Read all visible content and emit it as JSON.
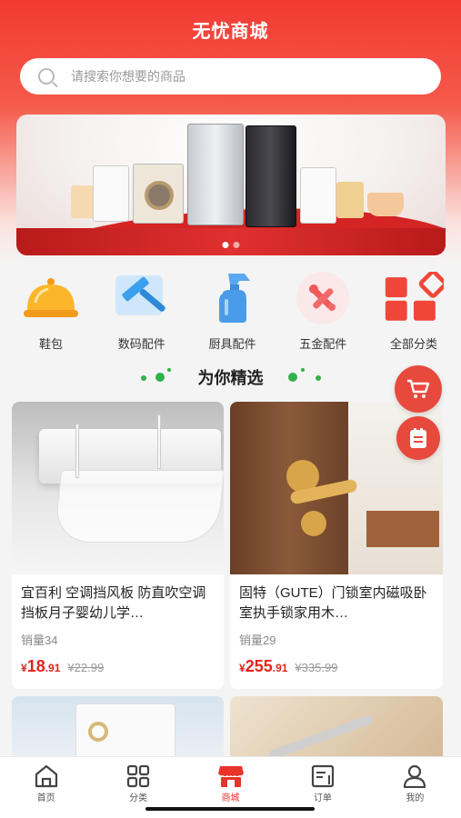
{
  "app": {
    "title": "无忧商城"
  },
  "search": {
    "placeholder": "请搜索你想要的商品"
  },
  "categories": [
    {
      "label": "鞋包",
      "icon": "food-cover-icon"
    },
    {
      "label": "数码配件",
      "icon": "squeegee-icon"
    },
    {
      "label": "厨具配件",
      "icon": "spray-bottle-icon"
    },
    {
      "label": "五金配件",
      "icon": "tools-icon"
    },
    {
      "label": "全部分类",
      "icon": "grid-icon"
    }
  ],
  "section": {
    "title": "为你精选"
  },
  "products": [
    {
      "name": "宜百利 空调挡风板 防直吹空调挡板月子婴幼儿学…",
      "sales": "销量34",
      "currency": "¥",
      "price_int": "18",
      "price_dec": ".91",
      "price_old": "¥22.99"
    },
    {
      "name": "固特（GUTE）门锁室内磁吸卧室执手锁家用木…",
      "sales": "销量29",
      "currency": "¥",
      "price_int": "255",
      "price_dec": ".91",
      "price_old": "¥335.99"
    }
  ],
  "tabs": [
    {
      "label": "首页",
      "icon": "home-icon"
    },
    {
      "label": "分类",
      "icon": "category-grid-icon"
    },
    {
      "label": "商城",
      "icon": "store-icon",
      "active": true
    },
    {
      "label": "订单",
      "icon": "order-icon"
    },
    {
      "label": "我的",
      "icon": "user-icon"
    }
  ],
  "colors": {
    "brand_red": "#e8342a",
    "price_red": "#e0241b",
    "accent_green": "#2fb24a"
  }
}
